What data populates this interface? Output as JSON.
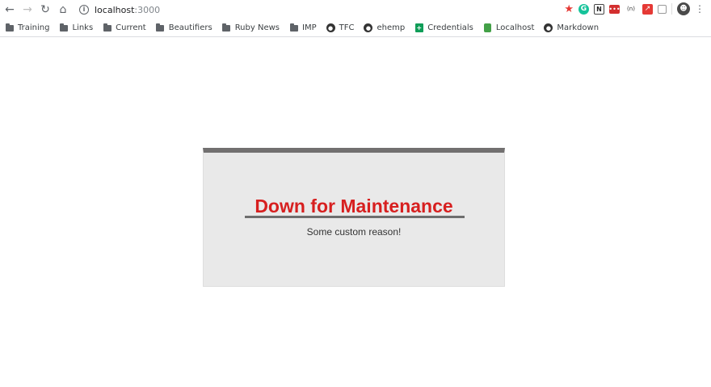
{
  "browser": {
    "url_host": "localhost",
    "url_port": ":3000",
    "icons": {
      "back": "arrow-left-icon",
      "forward": "arrow-right-icon",
      "reload": "reload-icon",
      "home": "home-icon",
      "site_info": "info-icon",
      "bookmark_star": "star-icon"
    },
    "extensions": [
      {
        "name": "grammarly-extension-icon",
        "glyph": "G"
      },
      {
        "name": "notion-extension-icon",
        "glyph": "N"
      },
      {
        "name": "dashlane-extension-icon",
        "glyph": "•••"
      },
      {
        "name": "postman-extension-icon",
        "glyph": "(n)"
      },
      {
        "name": "chart-extension-icon",
        "glyph": "↗"
      },
      {
        "name": "document-extension-icon",
        "glyph": ""
      }
    ],
    "colors": {
      "star": "#e53935"
    }
  },
  "bookmarks": [
    {
      "label": "Training",
      "icon": "folder-icon"
    },
    {
      "label": "Links",
      "icon": "folder-icon"
    },
    {
      "label": "Current",
      "icon": "folder-icon"
    },
    {
      "label": "Beautifiers",
      "icon": "folder-icon"
    },
    {
      "label": "Ruby News",
      "icon": "folder-icon"
    },
    {
      "label": "IMP",
      "icon": "folder-icon"
    },
    {
      "label": "TFC",
      "icon": "github-icon"
    },
    {
      "label": "ehemp",
      "icon": "github-icon"
    },
    {
      "label": "Credentials",
      "icon": "sheets-icon"
    },
    {
      "label": "Localhost",
      "icon": "lock-icon"
    },
    {
      "label": "Markdown",
      "icon": "github-icon"
    }
  ],
  "maintenance": {
    "title": "Down for Maintenance",
    "reason": "Some custom reason!",
    "colors": {
      "title": "#d71f1f",
      "card_background": "#e9e9e9",
      "card_top_border": "#727070",
      "rule": "#6e6e6e"
    }
  }
}
